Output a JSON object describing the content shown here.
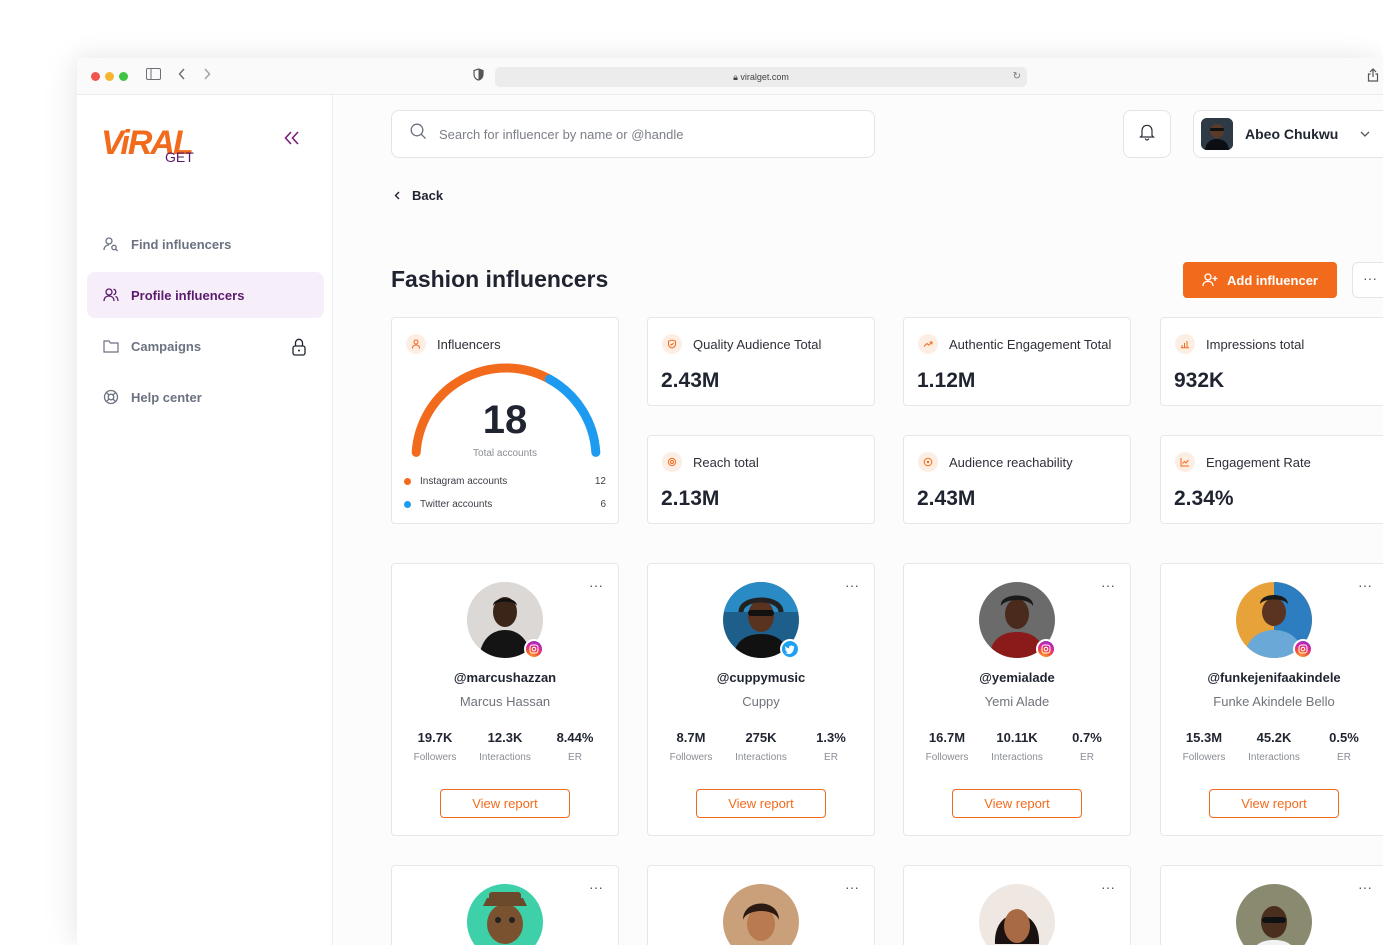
{
  "browser": {
    "url": "viralget.com"
  },
  "brand": {
    "logo_main": "ViRAL",
    "logo_sub": "GET",
    "accent": "#f26b1d",
    "brand_purple": "#5b1a6e"
  },
  "sidebar": {
    "items": [
      {
        "label": "Find influencers",
        "icon": "user-search-icon"
      },
      {
        "label": "Profile influencers",
        "icon": "users-icon",
        "active": true
      },
      {
        "label": "Campaigns",
        "icon": "folder-icon",
        "locked": true
      },
      {
        "label": "Help center",
        "icon": "lifebuoy-icon"
      }
    ]
  },
  "header": {
    "search_placeholder": "Search for influencer by name or @handle",
    "user_name": "Abeo Chukwu"
  },
  "page": {
    "back_label": "Back",
    "title": "Fashion influencers",
    "add_button": "Add influencer",
    "more_label": "···"
  },
  "summary": {
    "label": "Influencers",
    "total": "18",
    "total_label": "Total accounts",
    "instagram_label": "Instagram accounts",
    "instagram_count": "12",
    "twitter_label": "Twitter accounts",
    "twitter_count": "6",
    "instagram_color": "#f26b1d",
    "twitter_color": "#1d9bf0"
  },
  "stats": [
    {
      "label": "Quality Audience Total",
      "value": "2.43M"
    },
    {
      "label": "Authentic Engagement Total",
      "value": "1.12M"
    },
    {
      "label": "Impressions total",
      "value": "932K"
    },
    {
      "label": "Reach total",
      "value": "2.13M"
    },
    {
      "label": "Audience reachability",
      "value": "2.43M"
    },
    {
      "label": "Engagement Rate",
      "value": "2.34%"
    }
  ],
  "influencers": [
    {
      "handle": "@marcushazzan",
      "name": "Marcus Hassan",
      "platform": "instagram",
      "followers": "19.7K",
      "interactions": "12.3K",
      "er": "8.44%"
    },
    {
      "handle": "@cuppymusic",
      "name": "Cuppy",
      "platform": "twitter",
      "followers": "8.7M",
      "interactions": "275K",
      "er": "1.3%"
    },
    {
      "handle": "@yemialade",
      "name": "Yemi Alade",
      "platform": "instagram",
      "followers": "16.7M",
      "interactions": "10.11K",
      "er": "0.7%"
    },
    {
      "handle": "@funkejenifaakindele",
      "name": "Funke Akindele Bello",
      "platform": "instagram",
      "followers": "15.3M",
      "interactions": "45.2K",
      "er": "0.5%"
    }
  ],
  "labels": {
    "followers": "Followers",
    "interactions": "Interactions",
    "er": "ER",
    "view_report": "View report"
  }
}
